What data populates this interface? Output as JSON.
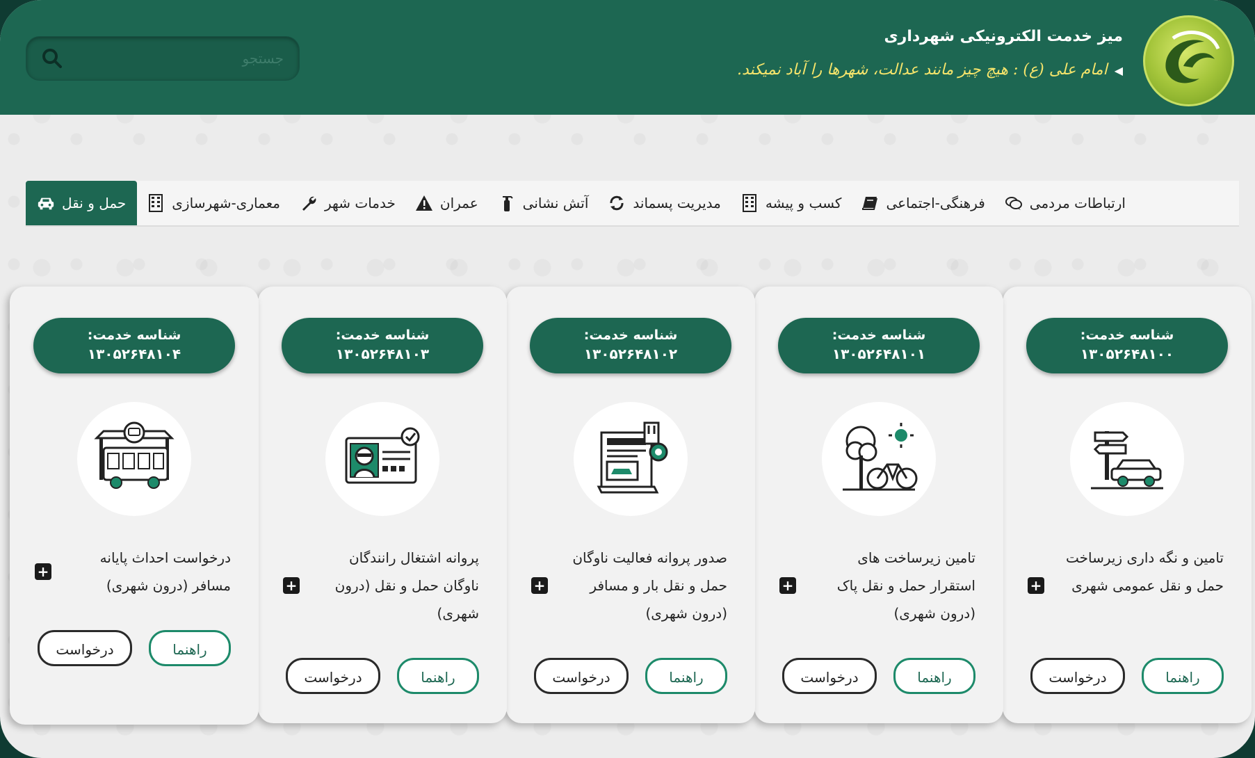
{
  "header": {
    "title": "میز خدمت الکترونیکی شهرداری",
    "quote": "امام علی (ع) : هیچ چیز مانند عدالت، شهرها را آباد نمیکند.",
    "search_placeholder": "جستجو"
  },
  "nav": {
    "items": [
      {
        "label": "حمل و نقل",
        "icon": "car-icon",
        "active": true
      },
      {
        "label": "معماری-شهرسازی",
        "icon": "building-icon"
      },
      {
        "label": "خدمات شهر",
        "icon": "wrench-icon"
      },
      {
        "label": "عمران",
        "icon": "warning-icon"
      },
      {
        "label": "آتش نشانی",
        "icon": "fire-extinguisher-icon"
      },
      {
        "label": "مدیریت پسماند",
        "icon": "recycle-icon"
      },
      {
        "label": "کسب و پیشه",
        "icon": "building-icon"
      },
      {
        "label": "فرهنگی-اجتماعی",
        "icon": "book-icon"
      },
      {
        "label": "ارتباطات مردمی",
        "icon": "comments-icon"
      }
    ]
  },
  "cards": [
    {
      "badge_label": "شناسه خدمت:",
      "service_id": "۱۳۰۵۲۶۴۸۱۰۰",
      "icon": "road-sign-car-icon",
      "title": "تامین و نگه داری زیرساخت حمل و نقل عمومی شهری",
      "guide_label": "راهنما",
      "request_label": "درخواست"
    },
    {
      "badge_label": "شناسه خدمت:",
      "service_id": "۱۳۰۵۲۶۴۸۱۰۱",
      "icon": "tree-bicycle-icon",
      "title": "تامین زیرساخت های استقرار حمل و نقل پاک (درون شهری)",
      "guide_label": "راهنما",
      "request_label": "درخواست"
    },
    {
      "badge_label": "شناسه خدمت:",
      "service_id": "۱۳۰۵۲۶۴۸۱۰۲",
      "icon": "document-car-icon",
      "title": "صدور پروانه فعالیت ناوگان حمل و نقل بار و مسافر (درون شهری)",
      "guide_label": "راهنما",
      "request_label": "درخواست"
    },
    {
      "badge_label": "شناسه خدمت:",
      "service_id": "۱۳۰۵۲۶۴۸۱۰۳",
      "icon": "driver-license-icon",
      "title": "پروانه اشتغال رانندگان ناوگان حمل و نقل (درون شهری)",
      "guide_label": "راهنما",
      "request_label": "درخواست"
    },
    {
      "badge_label": "شناسه خدمت:",
      "service_id": "۱۳۰۵۲۶۴۸۱۰۴",
      "icon": "bus-station-icon",
      "title": "درخواست احداث پایانه مسافر (درون شهری)",
      "guide_label": "راهنما",
      "request_label": "درخواست"
    }
  ],
  "colors": {
    "primary": "#1d6752",
    "quote": "#f5e46b",
    "accent_green": "#1d8a6a"
  }
}
